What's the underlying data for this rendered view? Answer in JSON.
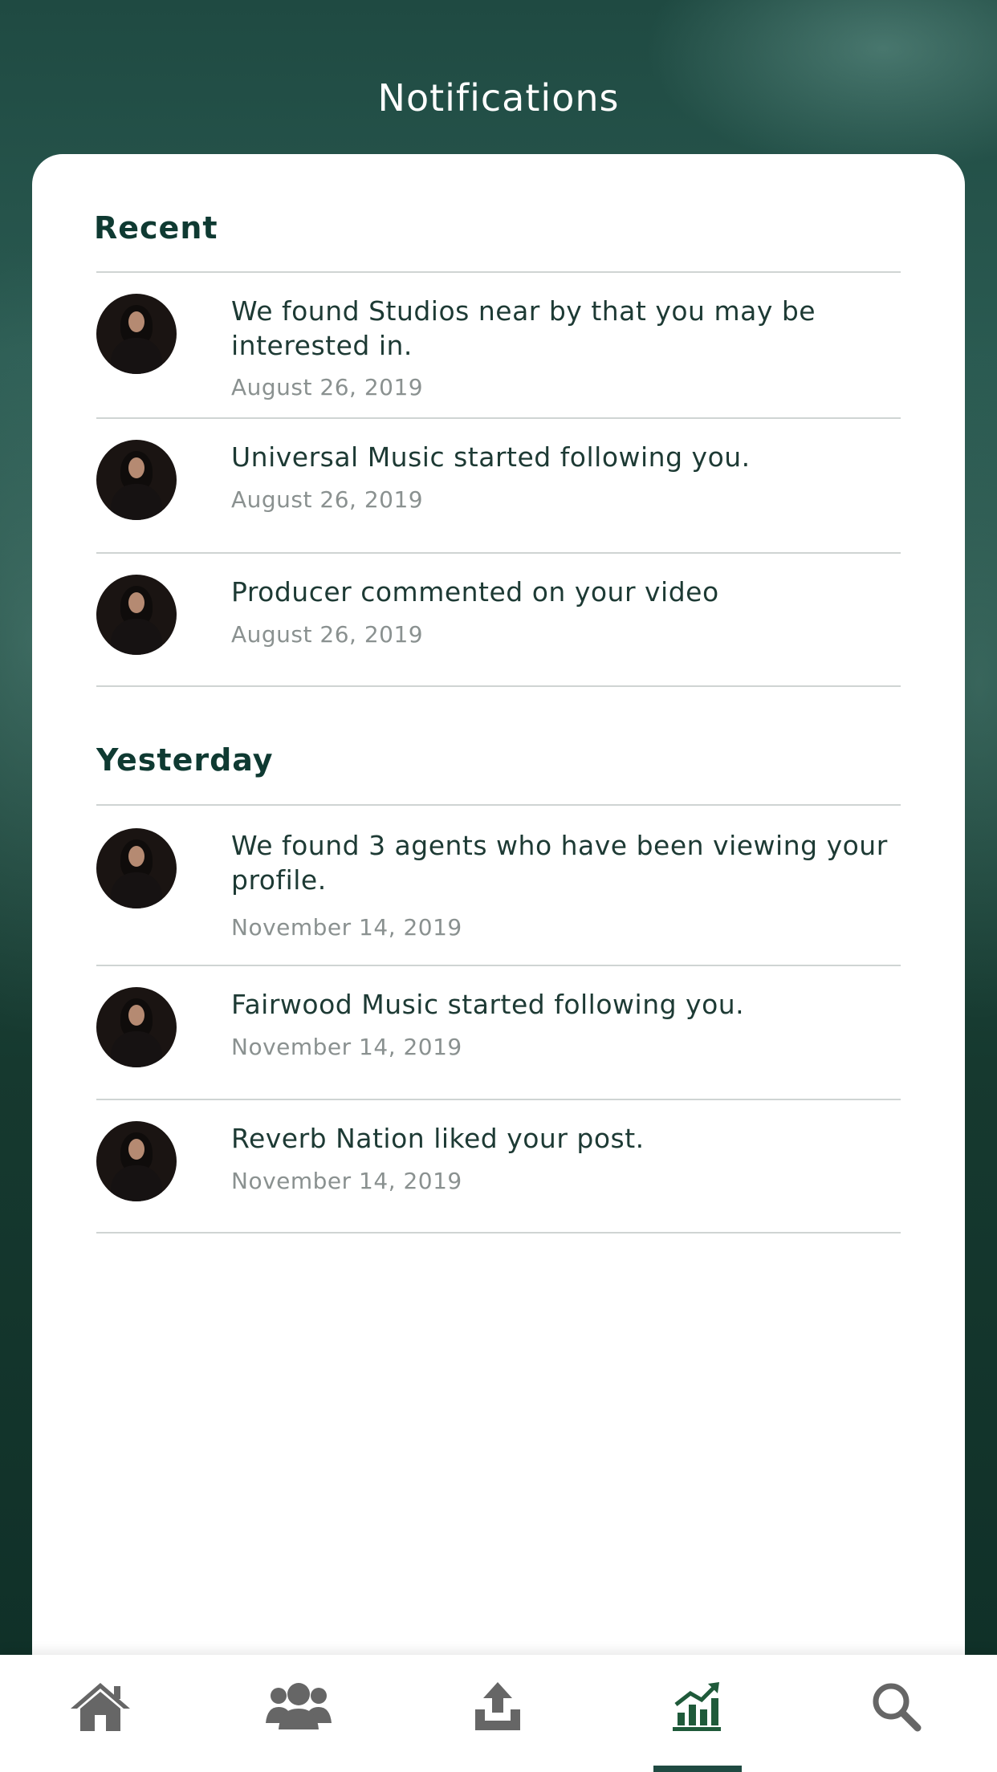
{
  "header": {
    "title": "Notifications"
  },
  "sections": [
    {
      "title": "Recent",
      "items": [
        {
          "message": "We found Studios near by that you may be interested in.",
          "date": "August 26, 2019"
        },
        {
          "message": "Universal Music started following you.",
          "date": "August 26, 2019"
        },
        {
          "message": "Producer commented on your video",
          "date": "August 26, 2019"
        }
      ]
    },
    {
      "title": "Yesterday",
      "items": [
        {
          "message": "We found 3 agents who have been viewing your profile.",
          "date": "November 14, 2019"
        },
        {
          "message": "Fairwood Music started following you.",
          "date": "November 14, 2019"
        },
        {
          "message": "Reverb Nation liked your post.",
          "date": "November 14, 2019"
        }
      ]
    }
  ],
  "tabbar": {
    "tabs": [
      {
        "icon": "home-icon"
      },
      {
        "icon": "users-icon"
      },
      {
        "icon": "upload-icon"
      },
      {
        "icon": "stats-icon",
        "active": true
      },
      {
        "icon": "search-icon"
      }
    ],
    "active_color": "#1f5a3a",
    "inactive_color": "#666666"
  }
}
